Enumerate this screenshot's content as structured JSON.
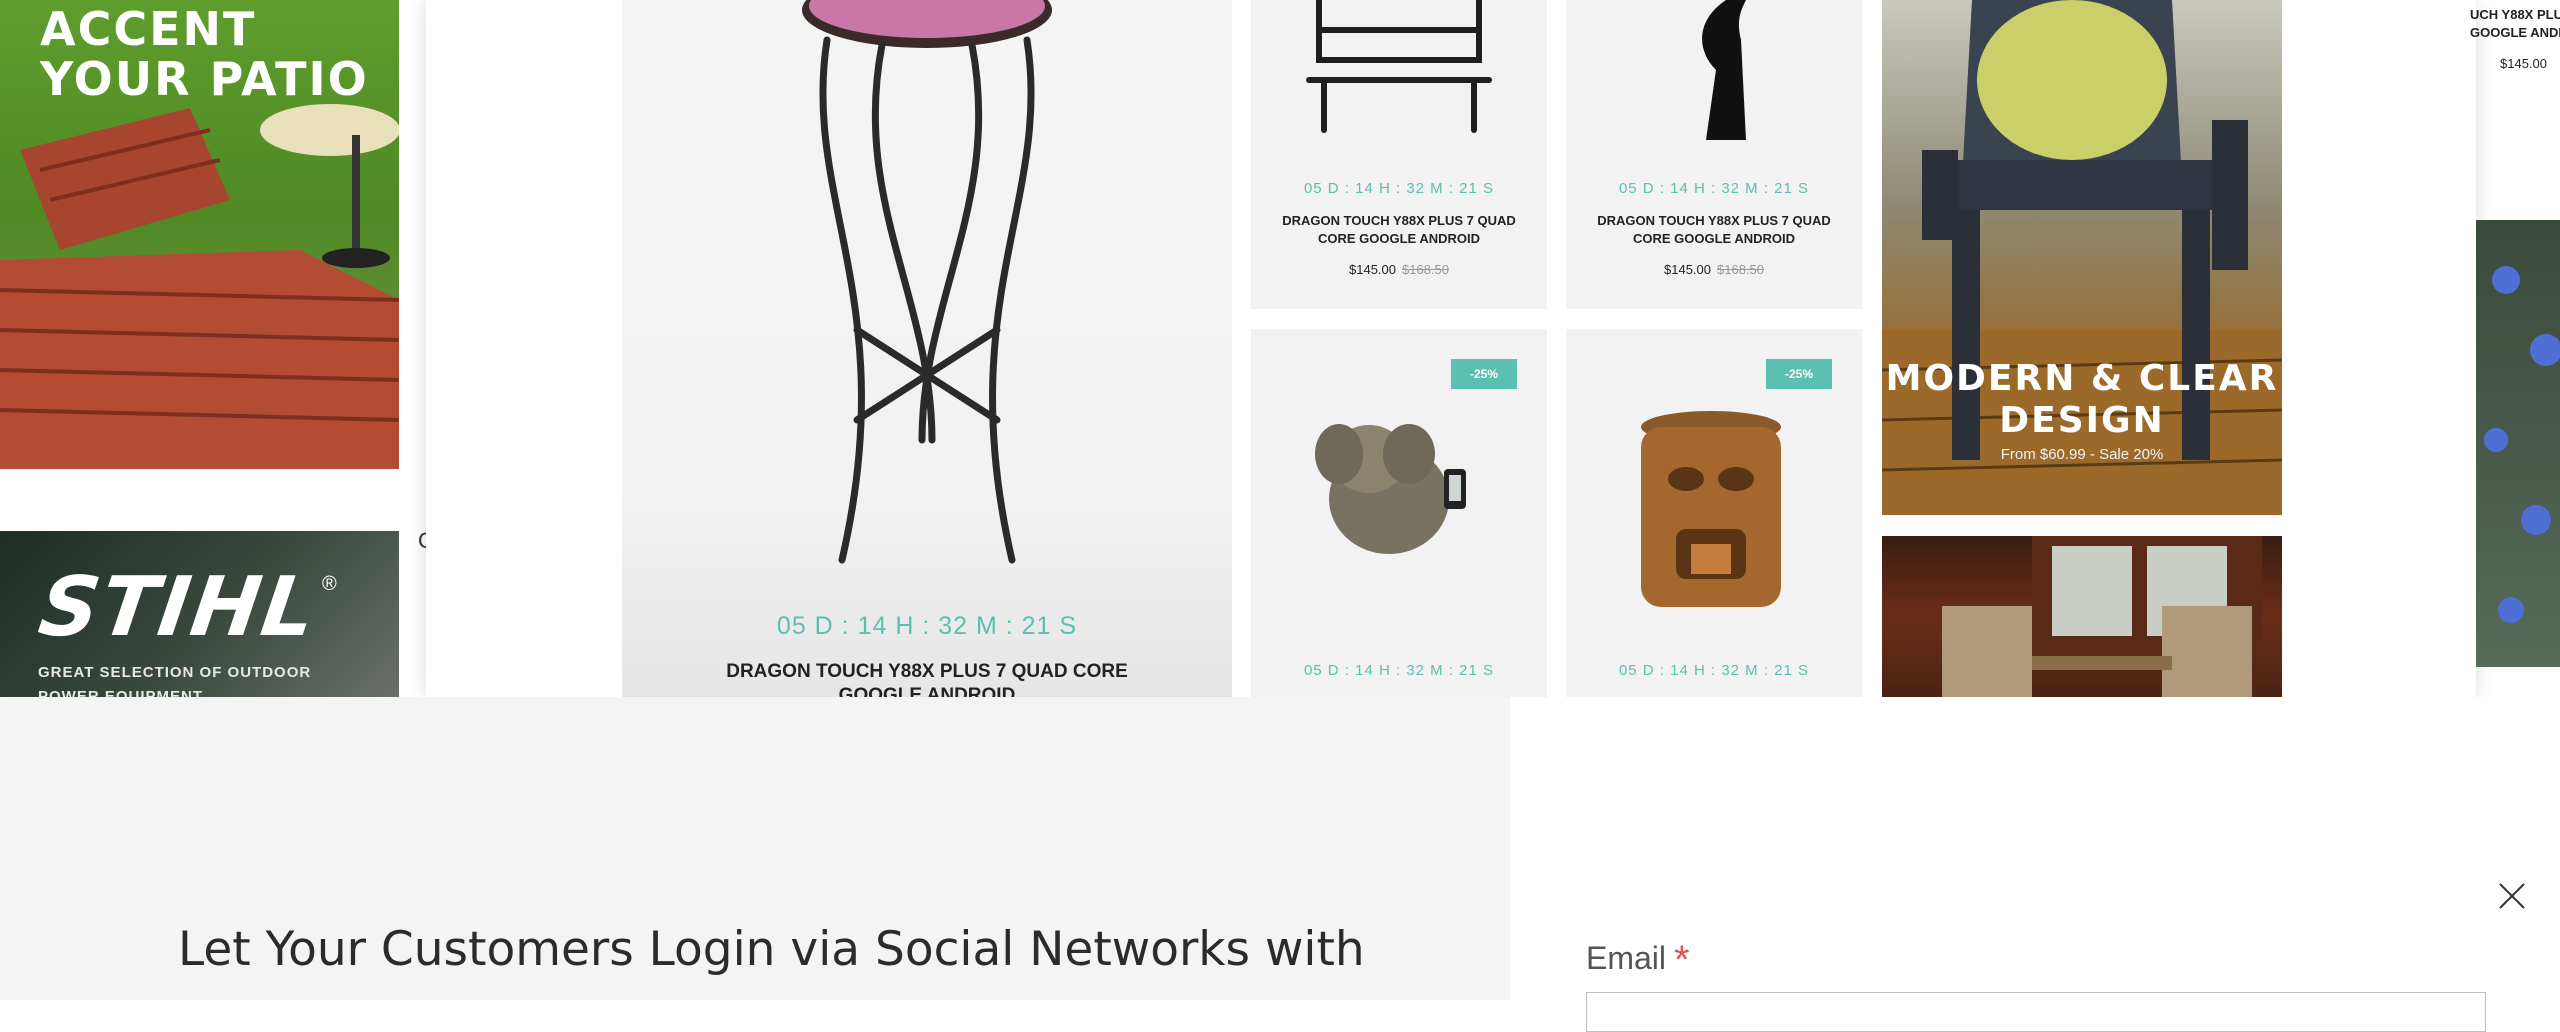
{
  "promos": {
    "patio_title_line1": "ACCENT",
    "patio_title_line2": "YOUR PATIO",
    "stihl_logo": "STIHL",
    "stihl_reg": "®",
    "stihl_subtitle": "GREAT SELECTION OF OUTDOOR POWER EQUIPMENT"
  },
  "featured": {
    "timer": "05 D  :  14 H  :  32 M  :  21 S",
    "name_line1": "DRAGON TOUCH Y88X PLUS 7 QUAD CORE",
    "name_line2": "GOOGLE ANDROID"
  },
  "products": [
    {
      "timer": "05 D  :  14 H  :  32 M  :  21 S",
      "name": "DRAGON TOUCH Y88X PLUS 7 QUAD CORE GOOGLE ANDROID",
      "price": "$145.00",
      "old_price": "$168.50"
    },
    {
      "timer": "05 D  :  14 H  :  32 M  :  21 S",
      "name": "DRAGON TOUCH Y88X PLUS 7 QUAD CORE GOOGLE ANDROID",
      "price": "$145.00",
      "old_price": "$168.50"
    },
    {
      "timer": "05 D  :  14 H  :  32 M  :  21 S",
      "badge": "-25%"
    },
    {
      "timer": "05 D  :  14 H  :  32 M  :  21 S",
      "badge": "-25%"
    }
  ],
  "chair_banner": {
    "title_line1": "MODERN & CLEAR",
    "title_line2": "DESIGN",
    "subtitle": "From $60.99 - Sale 20%"
  },
  "right_edge": {
    "name": "UCH Y88X PLU GOOGLE ANDR",
    "price": "$145.00"
  },
  "stray_letter": "C",
  "modal": {
    "heading": "Let Your Customers Login via Social Networks with",
    "email_label": "Email",
    "required_mark": "*",
    "email_value": "",
    "close_label": "×"
  },
  "colors": {
    "accent": "#5bbfb1",
    "required": "#e05454",
    "modal_bg": "#f4f4f4"
  },
  "icons": [
    "close-icon"
  ]
}
